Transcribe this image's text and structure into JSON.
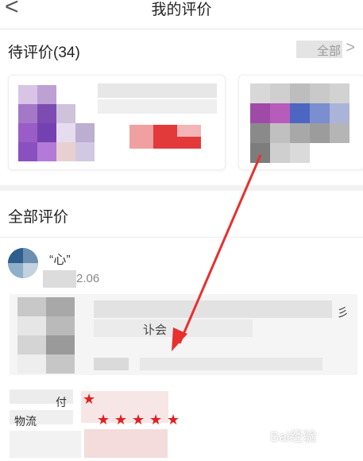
{
  "header": {
    "back_glyph": "<",
    "title": "我的评价"
  },
  "pending": {
    "title": "待评价(34)",
    "see_all": "全部",
    "chevron": ">"
  },
  "all": {
    "title": "全部评价",
    "review": {
      "username": "“心”",
      "date": "2.06",
      "text_a": "彡",
      "text_b": "讣会",
      "ratings": [
        {
          "label": "付",
          "stars": 1
        },
        {
          "label": "物流",
          "stars": 5
        }
      ]
    }
  },
  "watermark": "Bai经验",
  "colors": {
    "accent": "#e02020",
    "arrow": "#e8302f"
  }
}
